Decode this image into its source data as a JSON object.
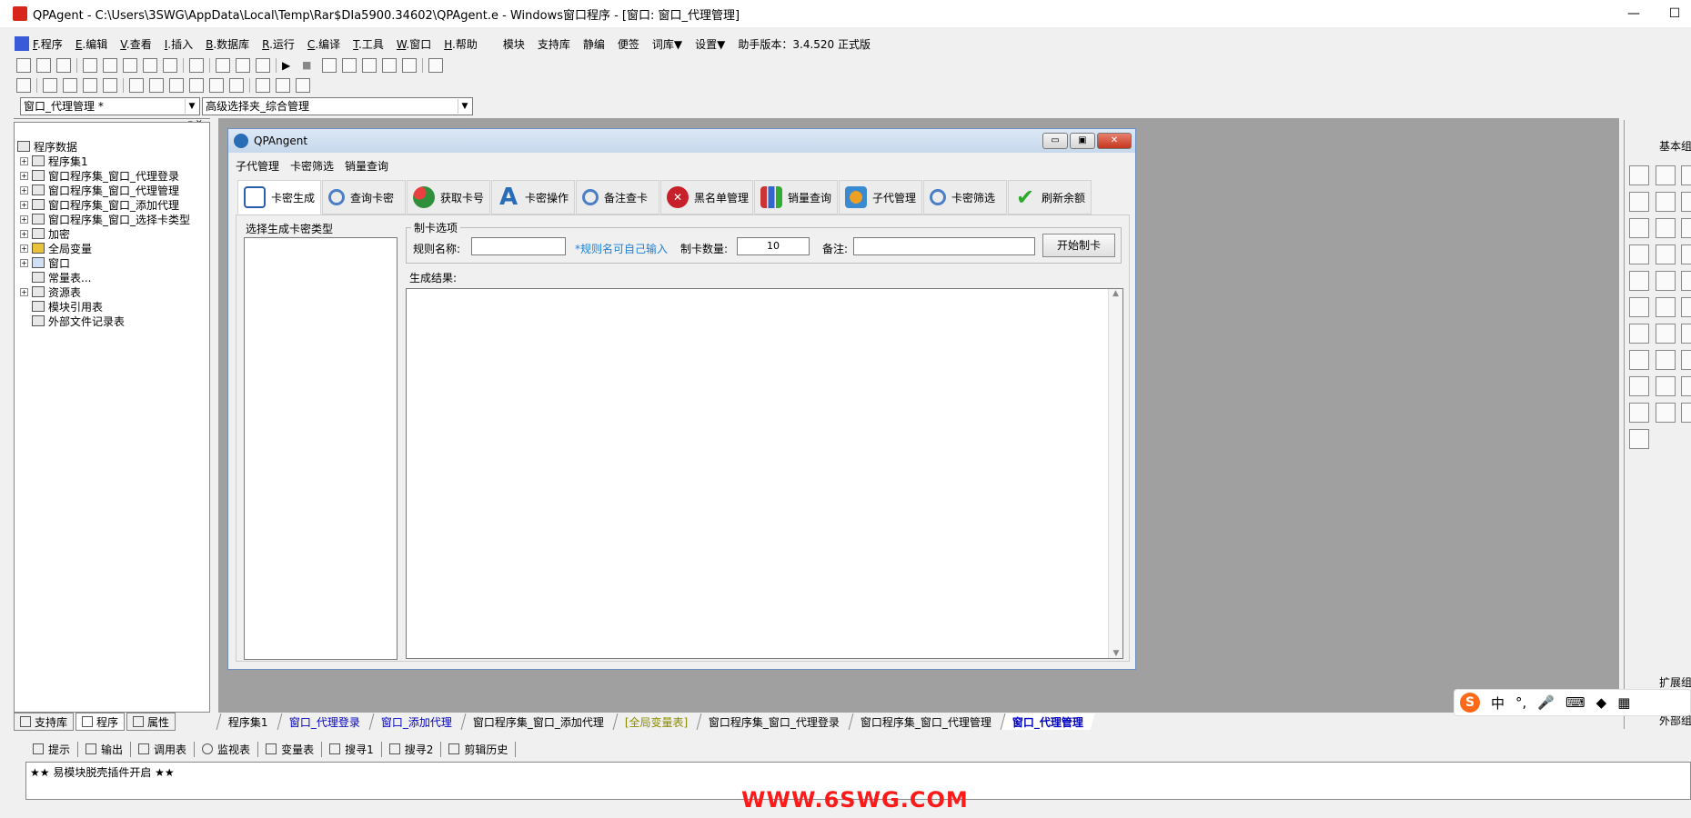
{
  "window": {
    "title": "QPAgent - C:\\Users\\3SWG\\AppData\\Local\\Temp\\Rar$DIa5900.34602\\QPAgent.e - Windows窗口程序 - [窗口: 窗口_代理管理]",
    "minimize": "—",
    "maximize": "☐"
  },
  "menu": [
    {
      "key": "F",
      "label": ".程序"
    },
    {
      "key": "E",
      "label": ".编辑"
    },
    {
      "key": "V",
      "label": ".查看"
    },
    {
      "key": "I",
      "label": ".插入"
    },
    {
      "key": "B",
      "label": ".数据库"
    },
    {
      "key": "R",
      "label": ".运行"
    },
    {
      "key": "C",
      "label": ".编译"
    },
    {
      "key": "T",
      "label": ".工具"
    },
    {
      "key": "W",
      "label": ".窗口"
    },
    {
      "key": "H",
      "label": ".帮助"
    },
    {
      "key": "",
      "label": "模块"
    },
    {
      "key": "",
      "label": "支持库"
    },
    {
      "key": "",
      "label": "静编"
    },
    {
      "key": "",
      "label": "便签"
    },
    {
      "key": "",
      "label": "词库▼"
    },
    {
      "key": "",
      "label": "设置▼"
    },
    {
      "key": "",
      "label": "助手版本：3.4.520 正式版"
    }
  ],
  "combos": {
    "window_select": "窗口_代理管理 *",
    "object_select": "高级选择夹_综合管理"
  },
  "tree": {
    "root": "程序数据",
    "items": [
      "程序集1",
      "窗口程序集_窗口_代理登录",
      "窗口程序集_窗口_代理管理",
      "窗口程序集_窗口_添加代理",
      "窗口程序集_窗口_选择卡类型",
      "加密",
      "全局变量",
      "窗口",
      "常量表...",
      "资源表",
      "模块引用表",
      "外部文件记录表"
    ]
  },
  "left_tabs": [
    "支持库",
    "程序",
    "属性"
  ],
  "inner_window": {
    "title": "QPAngent",
    "menu": [
      "子代管理",
      "卡密筛选",
      "销量查询"
    ],
    "tabs": [
      "卡密生成",
      "查询卡密",
      "获取卡号",
      "卡密操作",
      "备注查卡",
      "黑名单管理",
      "销量查询",
      "子代管理",
      "卡密筛选",
      "刷新余额"
    ],
    "list_label": "选择生成卡密类型",
    "group_label": "制卡选项",
    "rule_label": "规则名称:",
    "rule_hint": "*规则名可自己输入",
    "count_label": "制卡数量:",
    "count_value": "10",
    "note_label": "备注:",
    "start_button": "开始制卡",
    "result_label": "生成结果:"
  },
  "doc_tabs": [
    "程序集1",
    "窗口_代理登录",
    "窗口_添加代理",
    "窗口程序集_窗口_添加代理",
    "[全局变量表]",
    "窗口程序集_窗口_代理登录",
    "窗口程序集_窗口_代理管理",
    "窗口_代理管理"
  ],
  "output_tabs": [
    "提示",
    "输出",
    "调用表",
    "监视表",
    "变量表",
    "搜寻1",
    "搜寻2",
    "剪辑历史"
  ],
  "output_text": "★★ 易模块脱壳插件开启 ★★",
  "right_panel": {
    "basic_label": "基本组",
    "ext_label": "扩展组",
    "ext2_label": "外部组"
  },
  "ime": [
    "中",
    "°,",
    "🎤",
    "⌨"
  ],
  "watermark": "WWW.6SWG.COM"
}
